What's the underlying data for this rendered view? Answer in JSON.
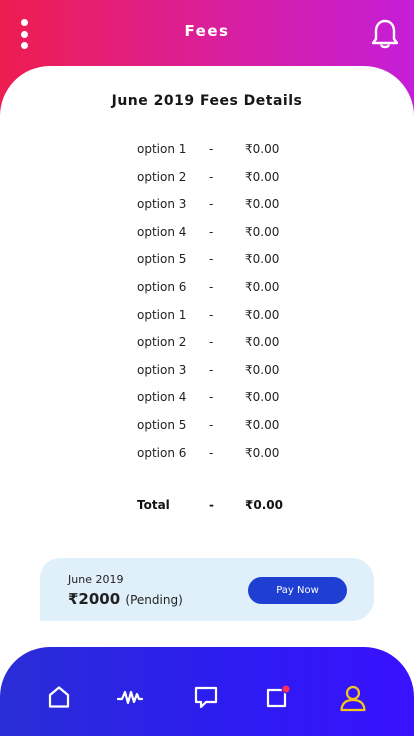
{
  "header": {
    "title": "Fees",
    "menu_icon": "more-vertical-icon",
    "bell_icon": "bell-icon"
  },
  "fees": {
    "heading": "June 2019 Fees Details",
    "items": [
      {
        "label": "option 1",
        "separator": "-",
        "amount": "₹0.00"
      },
      {
        "label": "option 2",
        "separator": "-",
        "amount": "₹0.00"
      },
      {
        "label": "option 3",
        "separator": "-",
        "amount": "₹0.00"
      },
      {
        "label": "option 4",
        "separator": "-",
        "amount": "₹0.00"
      },
      {
        "label": "option 5",
        "separator": "-",
        "amount": "₹0.00"
      },
      {
        "label": "option 6",
        "separator": "-",
        "amount": "₹0.00"
      },
      {
        "label": "option 1",
        "separator": "-",
        "amount": "₹0.00"
      },
      {
        "label": "option 2",
        "separator": "-",
        "amount": "₹0.00"
      },
      {
        "label": "option 3",
        "separator": "-",
        "amount": "₹0.00"
      },
      {
        "label": "option 4",
        "separator": "-",
        "amount": "₹0.00"
      },
      {
        "label": "option 5",
        "separator": "-",
        "amount": "₹0.00"
      },
      {
        "label": "option 6",
        "separator": "-",
        "amount": "₹0.00"
      }
    ],
    "total": {
      "label": "Total",
      "separator": "-",
      "amount": "₹0.00"
    }
  },
  "payment": {
    "month": "June 2019",
    "amount": "₹2000",
    "status": "(Pending)",
    "button_label": "Pay Now"
  },
  "nav": {
    "items": [
      {
        "icon": "home-icon"
      },
      {
        "icon": "activity-icon"
      },
      {
        "icon": "message-icon"
      },
      {
        "icon": "notification-icon"
      },
      {
        "icon": "user-icon",
        "active": true
      }
    ]
  },
  "colors": {
    "header_gradient_start": "#ee1d4f",
    "header_gradient_end": "#c41ed8",
    "nav_gradient_start": "#2a2ed6",
    "nav_gradient_end": "#3a11ff",
    "pay_box_background": "#dff0fb",
    "pay_button": "#1f3fd2",
    "active_icon": "#f5c518",
    "badge": "#ff2d55"
  }
}
